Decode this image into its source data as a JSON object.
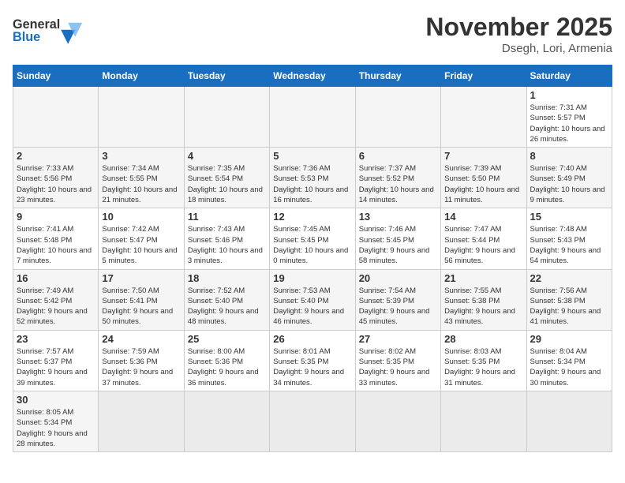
{
  "header": {
    "logo_general": "General",
    "logo_blue": "Blue",
    "month_title": "November 2025",
    "location": "Dsegh, Lori, Armenia"
  },
  "days_of_week": [
    "Sunday",
    "Monday",
    "Tuesday",
    "Wednesday",
    "Thursday",
    "Friday",
    "Saturday"
  ],
  "weeks": [
    [
      {
        "day": "",
        "info": ""
      },
      {
        "day": "",
        "info": ""
      },
      {
        "day": "",
        "info": ""
      },
      {
        "day": "",
        "info": ""
      },
      {
        "day": "",
        "info": ""
      },
      {
        "day": "",
        "info": ""
      },
      {
        "day": "1",
        "info": "Sunrise: 7:31 AM\nSunset: 5:57 PM\nDaylight: 10 hours and 26 minutes."
      }
    ],
    [
      {
        "day": "2",
        "info": "Sunrise: 7:33 AM\nSunset: 5:56 PM\nDaylight: 10 hours and 23 minutes."
      },
      {
        "day": "3",
        "info": "Sunrise: 7:34 AM\nSunset: 5:55 PM\nDaylight: 10 hours and 21 minutes."
      },
      {
        "day": "4",
        "info": "Sunrise: 7:35 AM\nSunset: 5:54 PM\nDaylight: 10 hours and 18 minutes."
      },
      {
        "day": "5",
        "info": "Sunrise: 7:36 AM\nSunset: 5:53 PM\nDaylight: 10 hours and 16 minutes."
      },
      {
        "day": "6",
        "info": "Sunrise: 7:37 AM\nSunset: 5:52 PM\nDaylight: 10 hours and 14 minutes."
      },
      {
        "day": "7",
        "info": "Sunrise: 7:39 AM\nSunset: 5:50 PM\nDaylight: 10 hours and 11 minutes."
      },
      {
        "day": "8",
        "info": "Sunrise: 7:40 AM\nSunset: 5:49 PM\nDaylight: 10 hours and 9 minutes."
      }
    ],
    [
      {
        "day": "9",
        "info": "Sunrise: 7:41 AM\nSunset: 5:48 PM\nDaylight: 10 hours and 7 minutes."
      },
      {
        "day": "10",
        "info": "Sunrise: 7:42 AM\nSunset: 5:47 PM\nDaylight: 10 hours and 5 minutes."
      },
      {
        "day": "11",
        "info": "Sunrise: 7:43 AM\nSunset: 5:46 PM\nDaylight: 10 hours and 3 minutes."
      },
      {
        "day": "12",
        "info": "Sunrise: 7:45 AM\nSunset: 5:45 PM\nDaylight: 10 hours and 0 minutes."
      },
      {
        "day": "13",
        "info": "Sunrise: 7:46 AM\nSunset: 5:45 PM\nDaylight: 9 hours and 58 minutes."
      },
      {
        "day": "14",
        "info": "Sunrise: 7:47 AM\nSunset: 5:44 PM\nDaylight: 9 hours and 56 minutes."
      },
      {
        "day": "15",
        "info": "Sunrise: 7:48 AM\nSunset: 5:43 PM\nDaylight: 9 hours and 54 minutes."
      }
    ],
    [
      {
        "day": "16",
        "info": "Sunrise: 7:49 AM\nSunset: 5:42 PM\nDaylight: 9 hours and 52 minutes."
      },
      {
        "day": "17",
        "info": "Sunrise: 7:50 AM\nSunset: 5:41 PM\nDaylight: 9 hours and 50 minutes."
      },
      {
        "day": "18",
        "info": "Sunrise: 7:52 AM\nSunset: 5:40 PM\nDaylight: 9 hours and 48 minutes."
      },
      {
        "day": "19",
        "info": "Sunrise: 7:53 AM\nSunset: 5:40 PM\nDaylight: 9 hours and 46 minutes."
      },
      {
        "day": "20",
        "info": "Sunrise: 7:54 AM\nSunset: 5:39 PM\nDaylight: 9 hours and 45 minutes."
      },
      {
        "day": "21",
        "info": "Sunrise: 7:55 AM\nSunset: 5:38 PM\nDaylight: 9 hours and 43 minutes."
      },
      {
        "day": "22",
        "info": "Sunrise: 7:56 AM\nSunset: 5:38 PM\nDaylight: 9 hours and 41 minutes."
      }
    ],
    [
      {
        "day": "23",
        "info": "Sunrise: 7:57 AM\nSunset: 5:37 PM\nDaylight: 9 hours and 39 minutes."
      },
      {
        "day": "24",
        "info": "Sunrise: 7:59 AM\nSunset: 5:36 PM\nDaylight: 9 hours and 37 minutes."
      },
      {
        "day": "25",
        "info": "Sunrise: 8:00 AM\nSunset: 5:36 PM\nDaylight: 9 hours and 36 minutes."
      },
      {
        "day": "26",
        "info": "Sunrise: 8:01 AM\nSunset: 5:35 PM\nDaylight: 9 hours and 34 minutes."
      },
      {
        "day": "27",
        "info": "Sunrise: 8:02 AM\nSunset: 5:35 PM\nDaylight: 9 hours and 33 minutes."
      },
      {
        "day": "28",
        "info": "Sunrise: 8:03 AM\nSunset: 5:35 PM\nDaylight: 9 hours and 31 minutes."
      },
      {
        "day": "29",
        "info": "Sunrise: 8:04 AM\nSunset: 5:34 PM\nDaylight: 9 hours and 30 minutes."
      }
    ],
    [
      {
        "day": "30",
        "info": "Sunrise: 8:05 AM\nSunset: 5:34 PM\nDaylight: 9 hours and 28 minutes."
      },
      {
        "day": "",
        "info": ""
      },
      {
        "day": "",
        "info": ""
      },
      {
        "day": "",
        "info": ""
      },
      {
        "day": "",
        "info": ""
      },
      {
        "day": "",
        "info": ""
      },
      {
        "day": "",
        "info": ""
      }
    ]
  ]
}
